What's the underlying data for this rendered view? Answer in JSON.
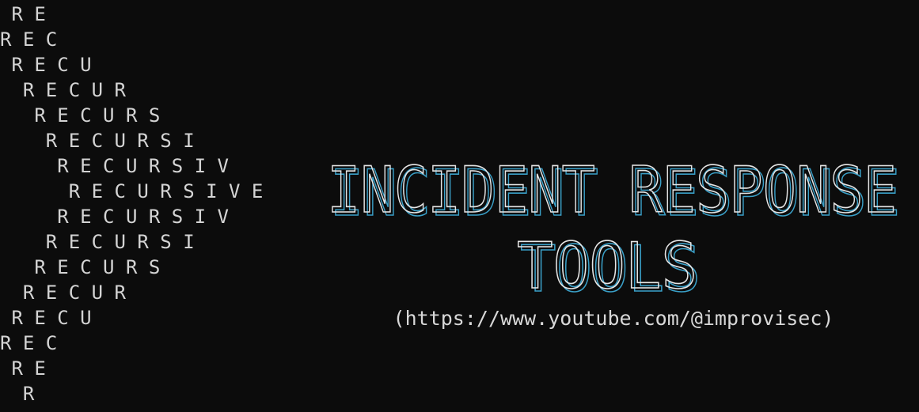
{
  "terminal": {
    "background": "#0c0c0c",
    "foreground": "#d4d4d4",
    "pyramid_lines": [
      " R E",
      "R E C",
      " R E C U",
      "  R E C U R",
      "   R E C U R S",
      "    R E C U R S I",
      "     R E C U R S I V",
      "      R E C U R S I V E",
      "     R E C U R S I V",
      "    R E C U R S I",
      "   R E C U R S",
      "  R E C U R",
      " R E C U",
      "R E C",
      " R E",
      "  R"
    ],
    "banner": {
      "line1": "INCIDENT RESPONSE",
      "line2": "TOOLS",
      "outline_color": "#e6e6e6",
      "shadow_color": "#3aa0c8"
    },
    "url": "(https://www.youtube.com/@improvisec)"
  }
}
